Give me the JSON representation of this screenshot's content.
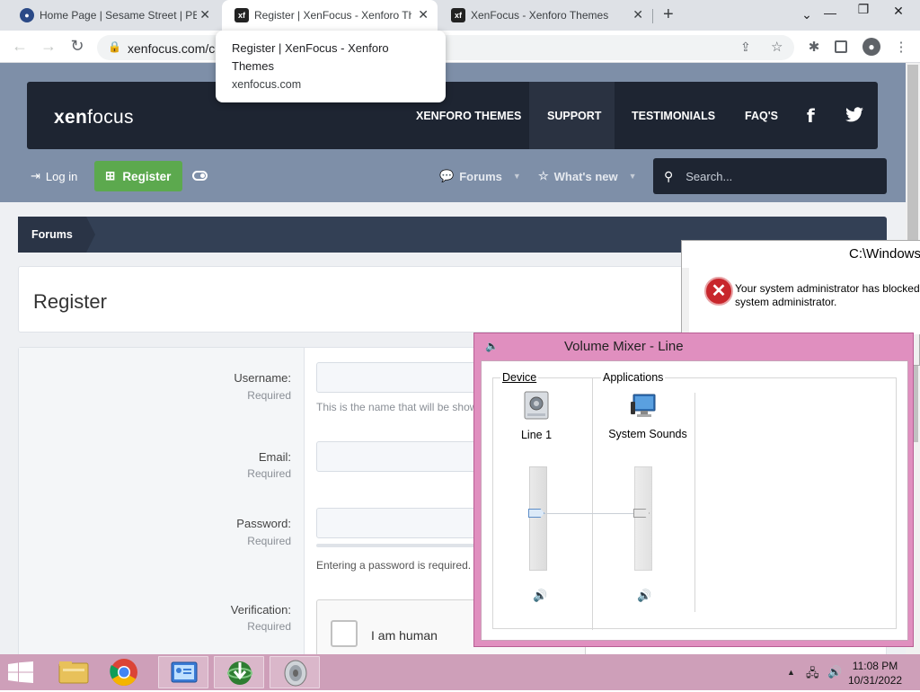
{
  "browser": {
    "tabs": [
      {
        "title": "Home Page | Sesame Street | PBS",
        "favicon": "pbs-icon",
        "active": false
      },
      {
        "title": "Register | XenFocus - Xenforo Th",
        "favicon": "xf-icon",
        "active": true
      },
      {
        "title": "XenFocus - Xenforo Themes",
        "favicon": "xf-icon",
        "active": false
      }
    ],
    "url": "xenfocus.com/c",
    "tooltip": {
      "title": "Register | XenFocus - Xenforo Themes",
      "domain": "xenfocus.com"
    }
  },
  "site": {
    "logo_left": "xen",
    "logo_right": "focus",
    "nav": [
      "XENFORO THEMES",
      "SUPPORT",
      "TESTIMONIALS",
      "FAQ'S"
    ],
    "social": {
      "facebook": "f",
      "twitter": "twitter-icon"
    },
    "login_label": "Log in",
    "register_label": "Register",
    "forums_label": "Forums",
    "whatsnew_label": "What's new",
    "search_placeholder": "Search...",
    "breadcrumb": "Forums",
    "page_title": "Register",
    "accent": "#5ca94e"
  },
  "form": {
    "username": {
      "label": "Username:",
      "req": "Required",
      "hint": "This is the name that will be show"
    },
    "email": {
      "label": "Email:",
      "req": "Required"
    },
    "password": {
      "label": "Password:",
      "req": "Required",
      "hint": "Entering a password is required."
    },
    "verification": {
      "label": "Verification:",
      "req": "Required",
      "captcha": "I am human"
    }
  },
  "error_dialog": {
    "title": "C:\\Windows\\",
    "line1": "Your system administrator has blocked",
    "line2": "system administrator."
  },
  "volume_mixer": {
    "title": "Volume Mixer - Line",
    "device_header": "Device",
    "apps_header": "Applications",
    "device_name": "Line 1",
    "app_name": "System Sounds",
    "device_level": 0.5,
    "app_level": 0.5
  },
  "taskbar": {
    "time": "11:08 PM",
    "date": "10/31/2022",
    "items": [
      "file-explorer-icon",
      "chrome-icon",
      "control-panel-icon",
      "internet-download-manager-icon",
      "speaker-icon"
    ]
  }
}
